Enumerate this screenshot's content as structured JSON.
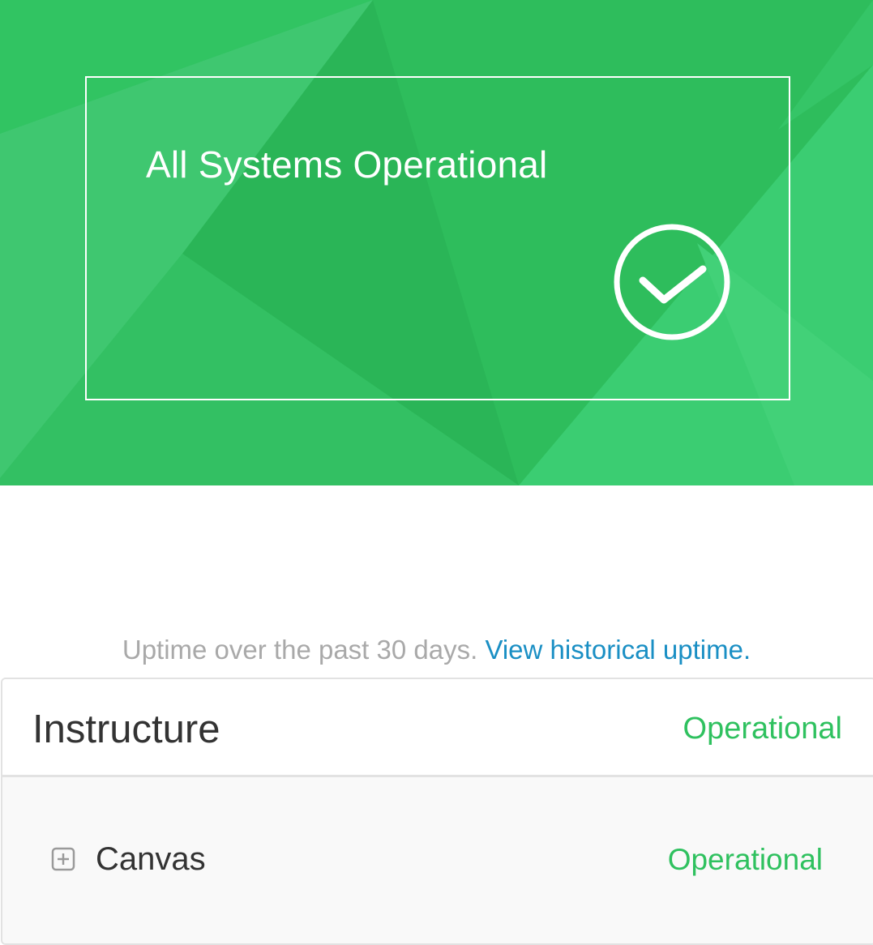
{
  "colors": {
    "operational_green": "#2fc15f",
    "link_blue": "#1a8fc4",
    "muted_text": "#a9a9a9",
    "dark_text": "#333333"
  },
  "hero": {
    "status_title": "All Systems Operational",
    "status_icon": "check-circle-icon"
  },
  "uptime": {
    "text": "Uptime over the past 30 days.",
    "link_text": "View historical uptime."
  },
  "components": {
    "group": {
      "name": "Instructure",
      "status": "Operational"
    },
    "children": [
      {
        "name": "Canvas",
        "status": "Operational",
        "expand_icon": "plus-square-icon"
      }
    ]
  }
}
